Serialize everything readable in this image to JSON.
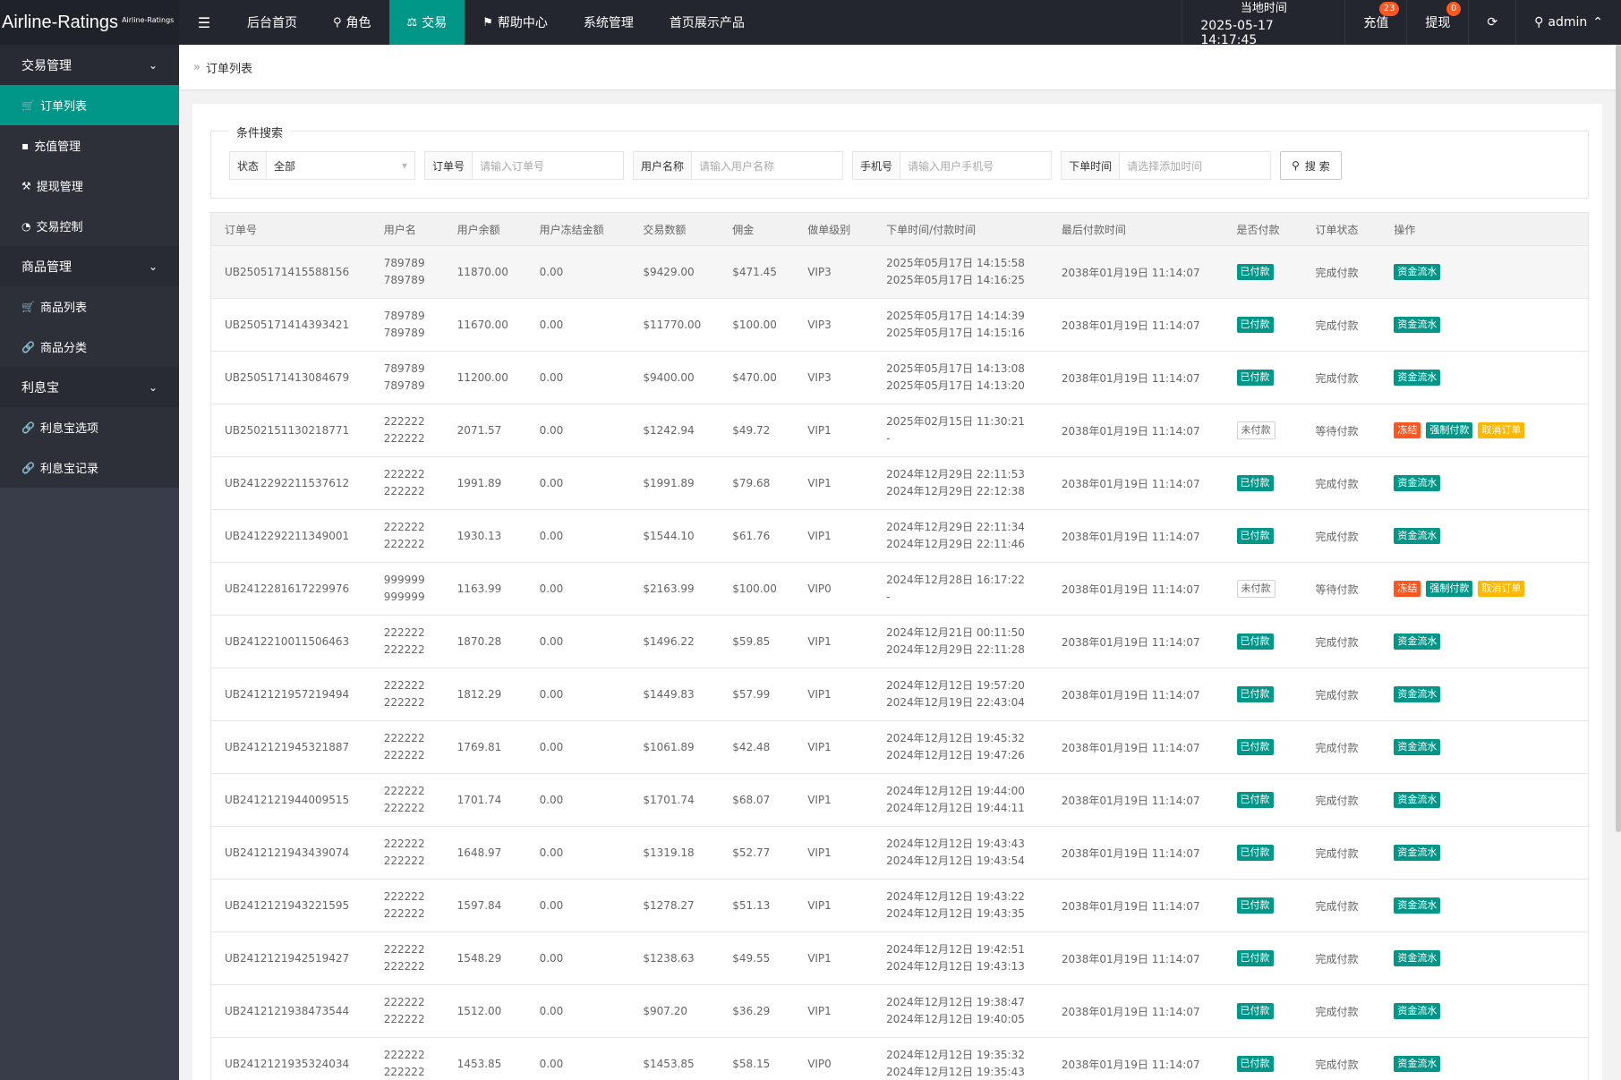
{
  "header": {
    "logo_main": "Airline-Ratings",
    "logo_small": "Airline-Ratings",
    "menu_icon": "hamburger-icon",
    "nav": [
      {
        "label": "后台首页",
        "icon": ""
      },
      {
        "label": "角色",
        "icon": "user-icon"
      },
      {
        "label": "交易",
        "icon": "scale-icon"
      },
      {
        "label": "帮助中心",
        "icon": "flag-icon"
      },
      {
        "label": "系统管理",
        "icon": ""
      },
      {
        "label": "首页展示产品",
        "icon": ""
      }
    ],
    "time_label": "当地时间",
    "time_value": "2025-05-17 14:17:45",
    "recharge_label": "充值",
    "recharge_count": "23",
    "withdraw_label": "提现",
    "withdraw_count": "0",
    "refresh_icon": "refresh-icon",
    "user_label": "admin"
  },
  "sidebar": {
    "groups": [
      {
        "label": "交易管理",
        "items": [
          {
            "label": "订单列表",
            "icon": "cart-icon",
            "active": true
          },
          {
            "label": "充值管理",
            "icon": "chat-icon"
          },
          {
            "label": "提现管理",
            "icon": "hammer-icon"
          },
          {
            "label": "交易控制",
            "icon": "dashboard-icon"
          }
        ]
      },
      {
        "label": "商品管理",
        "items": [
          {
            "label": "商品列表",
            "icon": "cart-icon"
          },
          {
            "label": "商品分类",
            "icon": "link-icon"
          }
        ]
      },
      {
        "label": "利息宝",
        "items": [
          {
            "label": "利息宝选项",
            "icon": "link-icon"
          },
          {
            "label": "利息宝记录",
            "icon": "link-icon"
          }
        ]
      }
    ]
  },
  "breadcrumb": {
    "label": "订单列表"
  },
  "search": {
    "legend": "条件搜索",
    "status_label": "状态",
    "status_value": "全部",
    "order_label": "订单号",
    "order_placeholder": "请输入订单号",
    "username_label": "用户名称",
    "username_placeholder": "请输入用户名称",
    "phone_label": "手机号",
    "phone_placeholder": "请输入用户手机号",
    "time_label": "下单时间",
    "time_placeholder": "请选择添加时间",
    "button_label": "搜 索"
  },
  "table": {
    "headers": [
      "订单号",
      "用户名",
      "用户余额",
      "用户冻结金额",
      "交易数额",
      "佣金",
      "做单级别",
      "下单时间/付款时间",
      "最后付款时间",
      "是否付款",
      "订单状态",
      "操作"
    ],
    "action_labels": {
      "flow": "资金流水",
      "freeze": "冻结",
      "force": "强制付款",
      "cancel": "取消订单"
    },
    "rows": [
      {
        "id": "UB2505171415588156",
        "user1": "789789",
        "user2": "789789",
        "balance": "11870.00",
        "frozen": "0.00",
        "amount": "$9429.00",
        "commission": "$471.45",
        "level": "VIP3",
        "t1": "2025年05月17日 14:15:58",
        "t2": "2025年05月17日 14:16:25",
        "last": "2038年01月19日 11:14:07",
        "paid": "已付款",
        "status": "完成付款",
        "pending": false
      },
      {
        "id": "UB2505171414393421",
        "user1": "789789",
        "user2": "789789",
        "balance": "11670.00",
        "frozen": "0.00",
        "amount": "$11770.00",
        "commission": "$100.00",
        "level": "VIP3",
        "t1": "2025年05月17日 14:14:39",
        "t2": "2025年05月17日 14:15:16",
        "last": "2038年01月19日 11:14:07",
        "paid": "已付款",
        "status": "完成付款",
        "pending": false
      },
      {
        "id": "UB2505171413084679",
        "user1": "789789",
        "user2": "789789",
        "balance": "11200.00",
        "frozen": "0.00",
        "amount": "$9400.00",
        "commission": "$470.00",
        "level": "VIP3",
        "t1": "2025年05月17日 14:13:08",
        "t2": "2025年05月17日 14:13:20",
        "last": "2038年01月19日 11:14:07",
        "paid": "已付款",
        "status": "完成付款",
        "pending": false
      },
      {
        "id": "UB2502151130218771",
        "user1": "222222",
        "user2": "222222",
        "balance": "2071.57",
        "frozen": "0.00",
        "amount": "$1242.94",
        "commission": "$49.72",
        "level": "VIP1",
        "t1": "2025年02月15日 11:30:21",
        "t2": "-",
        "last": "2038年01月19日 11:14:07",
        "paid": "未付款",
        "status": "等待付款",
        "pending": true
      },
      {
        "id": "UB2412292211537612",
        "user1": "222222",
        "user2": "222222",
        "balance": "1991.89",
        "frozen": "0.00",
        "amount": "$1991.89",
        "commission": "$79.68",
        "level": "VIP1",
        "t1": "2024年12月29日 22:11:53",
        "t2": "2024年12月29日 22:12:38",
        "last": "2038年01月19日 11:14:07",
        "paid": "已付款",
        "status": "完成付款",
        "pending": false
      },
      {
        "id": "UB2412292211349001",
        "user1": "222222",
        "user2": "222222",
        "balance": "1930.13",
        "frozen": "0.00",
        "amount": "$1544.10",
        "commission": "$61.76",
        "level": "VIP1",
        "t1": "2024年12月29日 22:11:34",
        "t2": "2024年12月29日 22:11:46",
        "last": "2038年01月19日 11:14:07",
        "paid": "已付款",
        "status": "完成付款",
        "pending": false
      },
      {
        "id": "UB2412281617229976",
        "user1": "999999",
        "user2": "999999",
        "balance": "1163.99",
        "frozen": "0.00",
        "amount": "$2163.99",
        "commission": "$100.00",
        "level": "VIP0",
        "t1": "2024年12月28日 16:17:22",
        "t2": "-",
        "last": "2038年01月19日 11:14:07",
        "paid": "未付款",
        "status": "等待付款",
        "pending": true
      },
      {
        "id": "UB2412210011506463",
        "user1": "222222",
        "user2": "222222",
        "balance": "1870.28",
        "frozen": "0.00",
        "amount": "$1496.22",
        "commission": "$59.85",
        "level": "VIP1",
        "t1": "2024年12月21日 00:11:50",
        "t2": "2024年12月29日 22:11:28",
        "last": "2038年01月19日 11:14:07",
        "paid": "已付款",
        "status": "完成付款",
        "pending": false
      },
      {
        "id": "UB2412121957219494",
        "user1": "222222",
        "user2": "222222",
        "balance": "1812.29",
        "frozen": "0.00",
        "amount": "$1449.83",
        "commission": "$57.99",
        "level": "VIP1",
        "t1": "2024年12月12日 19:57:20",
        "t2": "2024年12月19日 22:43:04",
        "last": "2038年01月19日 11:14:07",
        "paid": "已付款",
        "status": "完成付款",
        "pending": false
      },
      {
        "id": "UB2412121945321887",
        "user1": "222222",
        "user2": "222222",
        "balance": "1769.81",
        "frozen": "0.00",
        "amount": "$1061.89",
        "commission": "$42.48",
        "level": "VIP1",
        "t1": "2024年12月12日 19:45:32",
        "t2": "2024年12月12日 19:47:26",
        "last": "2038年01月19日 11:14:07",
        "paid": "已付款",
        "status": "完成付款",
        "pending": false
      },
      {
        "id": "UB2412121944009515",
        "user1": "222222",
        "user2": "222222",
        "balance": "1701.74",
        "frozen": "0.00",
        "amount": "$1701.74",
        "commission": "$68.07",
        "level": "VIP1",
        "t1": "2024年12月12日 19:44:00",
        "t2": "2024年12月12日 19:44:11",
        "last": "2038年01月19日 11:14:07",
        "paid": "已付款",
        "status": "完成付款",
        "pending": false
      },
      {
        "id": "UB2412121943439074",
        "user1": "222222",
        "user2": "222222",
        "balance": "1648.97",
        "frozen": "0.00",
        "amount": "$1319.18",
        "commission": "$52.77",
        "level": "VIP1",
        "t1": "2024年12月12日 19:43:43",
        "t2": "2024年12月12日 19:43:54",
        "last": "2038年01月19日 11:14:07",
        "paid": "已付款",
        "status": "完成付款",
        "pending": false
      },
      {
        "id": "UB2412121943221595",
        "user1": "222222",
        "user2": "222222",
        "balance": "1597.84",
        "frozen": "0.00",
        "amount": "$1278.27",
        "commission": "$51.13",
        "level": "VIP1",
        "t1": "2024年12月12日 19:43:22",
        "t2": "2024年12月12日 19:43:35",
        "last": "2038年01月19日 11:14:07",
        "paid": "已付款",
        "status": "完成付款",
        "pending": false
      },
      {
        "id": "UB2412121942519427",
        "user1": "222222",
        "user2": "222222",
        "balance": "1548.29",
        "frozen": "0.00",
        "amount": "$1238.63",
        "commission": "$49.55",
        "level": "VIP1",
        "t1": "2024年12月12日 19:42:51",
        "t2": "2024年12月12日 19:43:13",
        "last": "2038年01月19日 11:14:07",
        "paid": "已付款",
        "status": "完成付款",
        "pending": false
      },
      {
        "id": "UB2412121938473544",
        "user1": "222222",
        "user2": "222222",
        "balance": "1512.00",
        "frozen": "0.00",
        "amount": "$907.20",
        "commission": "$36.29",
        "level": "VIP1",
        "t1": "2024年12月12日 19:38:47",
        "t2": "2024年12月12日 19:40:05",
        "last": "2038年01月19日 11:14:07",
        "paid": "已付款",
        "status": "完成付款",
        "pending": false
      },
      {
        "id": "UB2412121935324034",
        "user1": "222222",
        "user2": "222222",
        "balance": "1453.85",
        "frozen": "0.00",
        "amount": "$1453.85",
        "commission": "$58.15",
        "level": "VIP0",
        "t1": "2024年12月12日 19:35:32",
        "t2": "2024年12月12日 19:35:43",
        "last": "2038年01月19日 11:14:07",
        "paid": "已付款",
        "status": "完成付款",
        "pending": false
      }
    ]
  },
  "colors": {
    "accent": "#009688",
    "topbar": "#23262e",
    "sidebar": "#393d49",
    "orange": "#ff5722",
    "yellow": "#ffb800"
  }
}
